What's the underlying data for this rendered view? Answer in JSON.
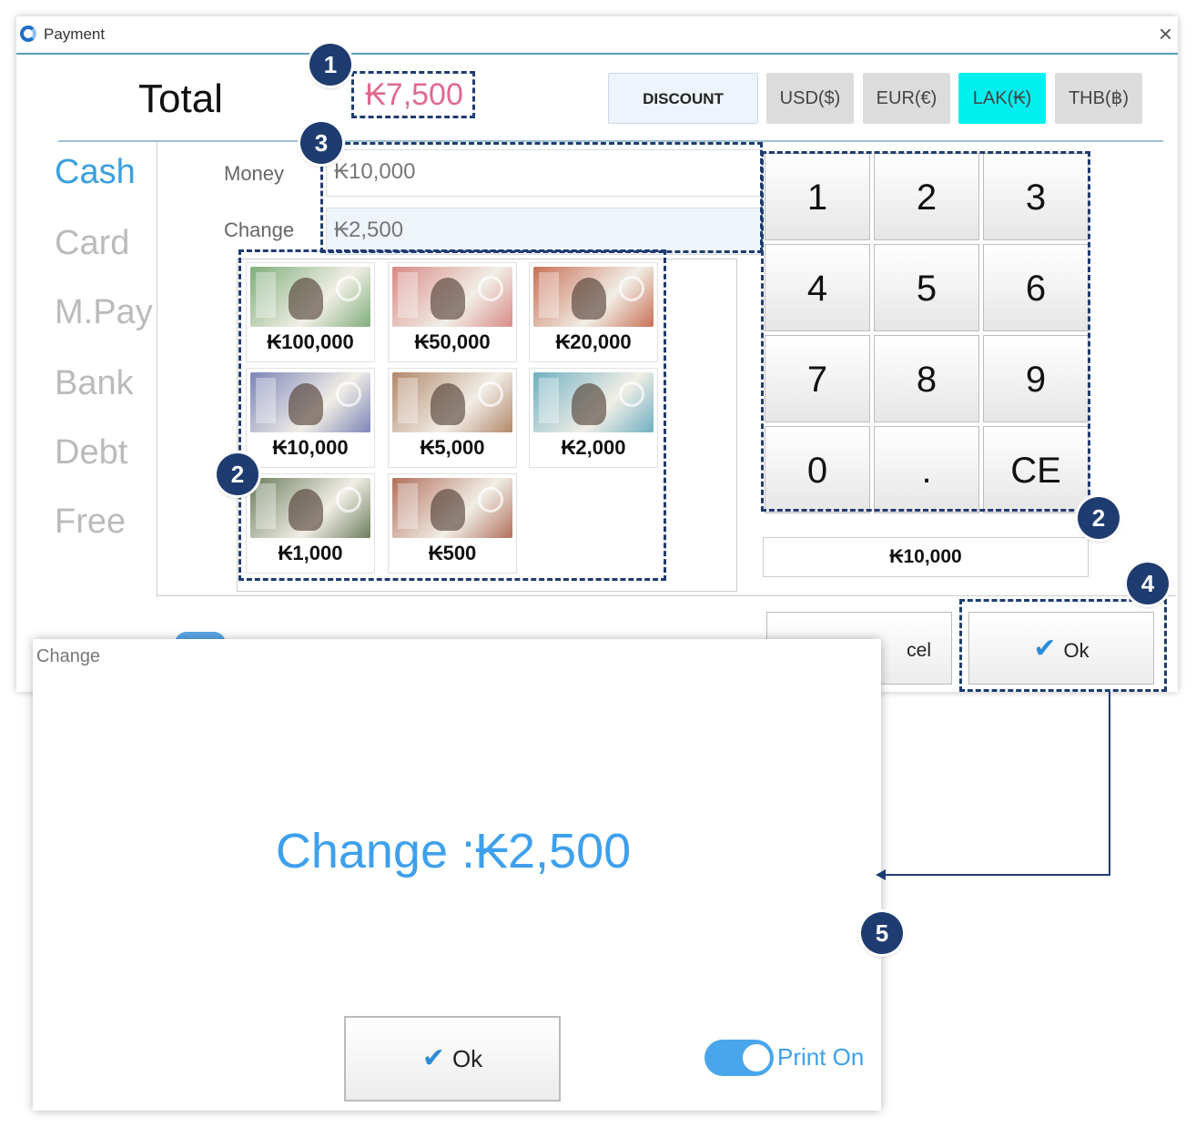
{
  "window": {
    "title": "Payment",
    "close_glyph": "×"
  },
  "total": {
    "label": "Total",
    "amount": "₭7,500"
  },
  "currency_buttons": {
    "discount": "DISCOUNT",
    "usd": "USD($)",
    "eur": "EUR(€)",
    "lak": "LAK(₭)",
    "thb": "THB(฿)",
    "active": "LAK(₭)",
    "active_color": "#00f0f0"
  },
  "payment_methods": [
    "Cash",
    "Card",
    "M.Pay",
    "Bank",
    "Debt",
    "Free"
  ],
  "active_method": "Cash",
  "fields": {
    "money_label": "Money",
    "money_value": "₭10,000",
    "change_label": "Change",
    "change_value": "₭2,500"
  },
  "banknotes": [
    {
      "label": "₭100,000",
      "color": "#7fae7a"
    },
    {
      "label": "₭50,000",
      "color": "#d98a86"
    },
    {
      "label": "₭20,000",
      "color": "#c97056"
    },
    {
      "label": "₭10,000",
      "color": "#7d84b8"
    },
    {
      "label": "₭5,000",
      "color": "#b2876a"
    },
    {
      "label": "₭2,000",
      "color": "#6fb0c2"
    },
    {
      "label": "₭1,000",
      "color": "#6c7d5c"
    },
    {
      "label": "₭500",
      "color": "#b2705c"
    }
  ],
  "keypad": {
    "keys": [
      "1",
      "2",
      "3",
      "4",
      "5",
      "6",
      "7",
      "8",
      "9",
      "0",
      ".",
      "CE"
    ],
    "display": "₭10,000"
  },
  "actions": {
    "cancel": "cel",
    "ok": "Ok"
  },
  "annotations": [
    "1",
    "2",
    "3",
    "2",
    "4",
    "5"
  ],
  "annotation_color": "#1f3c70",
  "change_dialog": {
    "title": "Change",
    "message": "Change :₭2,500",
    "ok": "Ok",
    "print_label": "Print On",
    "accent_color": "#3ea0ec"
  }
}
